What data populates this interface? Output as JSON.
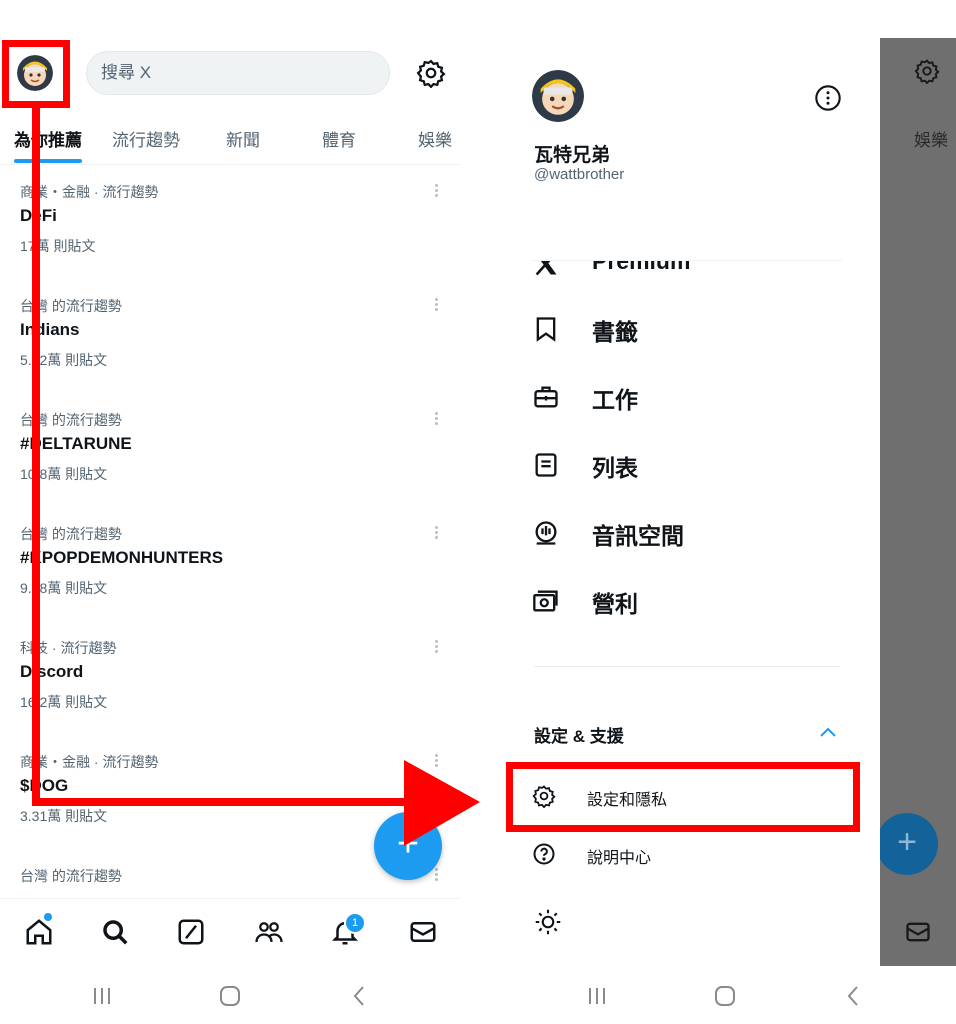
{
  "left": {
    "search_placeholder": "搜尋 X",
    "tabs": [
      {
        "label": "為你推薦",
        "active": true
      },
      {
        "label": "流行趨勢",
        "active": false
      },
      {
        "label": "新聞",
        "active": false
      },
      {
        "label": "體育",
        "active": false
      },
      {
        "label": "娛樂",
        "active": false
      }
    ],
    "trends": [
      {
        "context": "商業・金融 · 流行趨勢",
        "name": "DeFi",
        "count": "17萬 則貼文"
      },
      {
        "context": "台灣 的流行趨勢",
        "name": "Indians",
        "count": "5.12萬 則貼文"
      },
      {
        "context": "台灣 的流行趨勢",
        "name": "#DELTARUNE",
        "count": "10.8萬 則貼文"
      },
      {
        "context": "台灣 的流行趨勢",
        "name": "#KPOPDEMONHUNTERS",
        "count": "9.18萬 則貼文"
      },
      {
        "context": "科技 · 流行趨勢",
        "name": "Discord",
        "count": "16.2萬 則貼文"
      },
      {
        "context": "商業・金融 · 流行趨勢",
        "name": "$DOG",
        "count": "3.31萬 則貼文"
      },
      {
        "context": "台灣 的流行趨勢",
        "name": "",
        "count": ""
      }
    ],
    "fab_label": "+",
    "notification_badge": "1",
    "icons": [
      "home-icon",
      "search-icon",
      "grok-icon",
      "communities-icon",
      "notifications-icon",
      "messages-icon"
    ]
  },
  "drawer": {
    "display_name": "瓦特兄弟",
    "handle": "@wattbrother",
    "menu": [
      {
        "label": "Premium",
        "icon": "x-logo-icon"
      },
      {
        "label": "書籤",
        "icon": "bookmark-icon"
      },
      {
        "label": "工作",
        "icon": "briefcase-icon"
      },
      {
        "label": "列表",
        "icon": "list-icon"
      },
      {
        "label": "音訊空間",
        "icon": "spaces-icon"
      },
      {
        "label": "營利",
        "icon": "monetization-icon"
      }
    ],
    "section_title": "設定 & 支援",
    "sub_items": [
      {
        "label": "設定和隱私",
        "icon": "gear-icon"
      },
      {
        "label": "說明中心",
        "icon": "help-icon"
      }
    ],
    "display_icon": "sun-icon"
  },
  "background": {
    "tab_label": "娛樂"
  },
  "colors": {
    "accent": "#1d9bf0",
    "annotation": "#ff0000",
    "overlay": "#6f6f6f"
  }
}
